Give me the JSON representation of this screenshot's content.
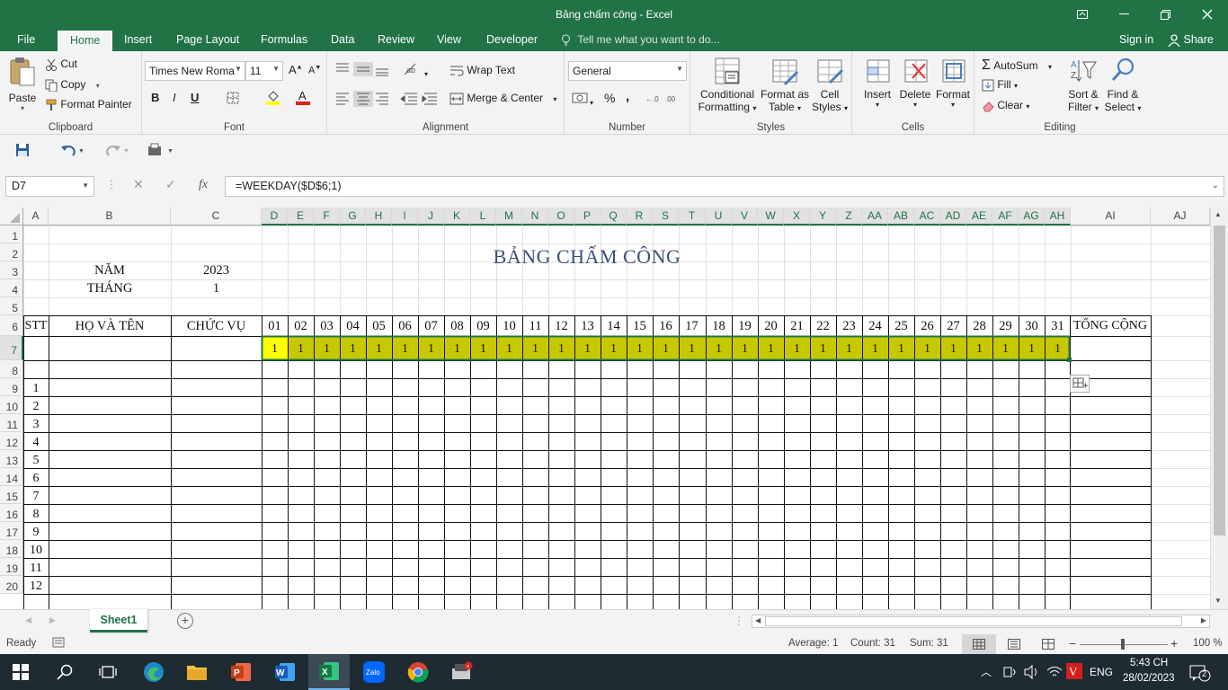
{
  "window": {
    "title": "Bảng chấm công - Excel"
  },
  "menu": {
    "tabs": [
      "File",
      "Home",
      "Insert",
      "Page Layout",
      "Formulas",
      "Data",
      "Review",
      "View",
      "Developer"
    ],
    "tell_me": "Tell me what you want to do...",
    "sign_in": "Sign in",
    "share": "Share"
  },
  "ribbon": {
    "clipboard": {
      "label": "Clipboard",
      "paste": "Paste",
      "cut": "Cut",
      "copy": "Copy",
      "format_painter": "Format Painter"
    },
    "font": {
      "label": "Font",
      "font_name": "Times New Roma",
      "font_size": "11",
      "bold": "B",
      "italic": "I",
      "underline": "U"
    },
    "alignment": {
      "label": "Alignment",
      "wrap_text": "Wrap Text",
      "merge_center": "Merge & Center"
    },
    "number": {
      "label": "Number",
      "format": "General",
      "percent": "%",
      "comma": ","
    },
    "styles": {
      "label": "Styles",
      "conditional_1": "Conditional",
      "conditional_2": "Formatting",
      "format_as_1": "Format as",
      "format_as_2": "Table",
      "cell_styles_1": "Cell",
      "cell_styles_2": "Styles"
    },
    "cells": {
      "label": "Cells",
      "insert": "Insert",
      "delete": "Delete",
      "format": "Format"
    },
    "editing": {
      "label": "Editing",
      "autosum": "AutoSum",
      "fill": "Fill",
      "clear": "Clear",
      "sort_1": "Sort &",
      "sort_2": "Filter",
      "find_1": "Find &",
      "find_2": "Select"
    }
  },
  "formula_bar": {
    "name_box": "D7",
    "formula": "=WEEKDAY($D$6;1)",
    "fx": "fx"
  },
  "sheet": {
    "columns": [
      "A",
      "B",
      "C",
      "D",
      "E",
      "F",
      "G",
      "H",
      "I",
      "J",
      "K",
      "L",
      "M",
      "N",
      "O",
      "P",
      "Q",
      "R",
      "S",
      "T",
      "U",
      "V",
      "W",
      "X",
      "Y",
      "Z",
      "AA",
      "AB",
      "AC",
      "AD",
      "AE",
      "AF",
      "AG",
      "AH",
      "AI",
      "AJ"
    ],
    "rows": [
      "1",
      "2",
      "3",
      "4",
      "5",
      "6",
      "7",
      "8",
      "9",
      "10",
      "11",
      "12",
      "13",
      "14",
      "15",
      "16",
      "17",
      "18",
      "19",
      "20"
    ],
    "title": "BẢNG CHẤM CÔNG",
    "nam_label": "NĂM",
    "nam_value": "2023",
    "thang_label": "THÁNG",
    "thang_value": "1",
    "header_stt": "STT",
    "header_name": "HỌ VÀ TÊN",
    "header_position": "CHỨC VỤ",
    "header_total": "TỔNG CỘNG",
    "days": [
      "01",
      "02",
      "03",
      "04",
      "05",
      "06",
      "07",
      "08",
      "09",
      "10",
      "11",
      "12",
      "13",
      "14",
      "15",
      "16",
      "17",
      "18",
      "19",
      "20",
      "21",
      "22",
      "23",
      "24",
      "25",
      "26",
      "27",
      "28",
      "29",
      "30",
      "31"
    ],
    "weekday_values": [
      "1",
      "1",
      "1",
      "1",
      "1",
      "1",
      "1",
      "1",
      "1",
      "1",
      "1",
      "1",
      "1",
      "1",
      "1",
      "1",
      "1",
      "1",
      "1",
      "1",
      "1",
      "1",
      "1",
      "1",
      "1",
      "1",
      "1",
      "1",
      "1",
      "1",
      "1"
    ],
    "stt_values": [
      "1",
      "2",
      "3",
      "4",
      "5",
      "6",
      "7",
      "8",
      "9",
      "10",
      "11",
      "12"
    ]
  },
  "sheet_tab": "Sheet1",
  "status": {
    "ready": "Ready",
    "average": "Average: 1",
    "count": "Count: 31",
    "sum": "Sum: 31",
    "zoom": "100 %"
  },
  "taskbar": {
    "lang": "ENG",
    "time": "5:43 CH",
    "date": "28/02/2023",
    "notifications": "2"
  },
  "colors": {
    "excel_green": "#217346",
    "highlight": "#c8c800",
    "active_cell": "#ffff00"
  }
}
